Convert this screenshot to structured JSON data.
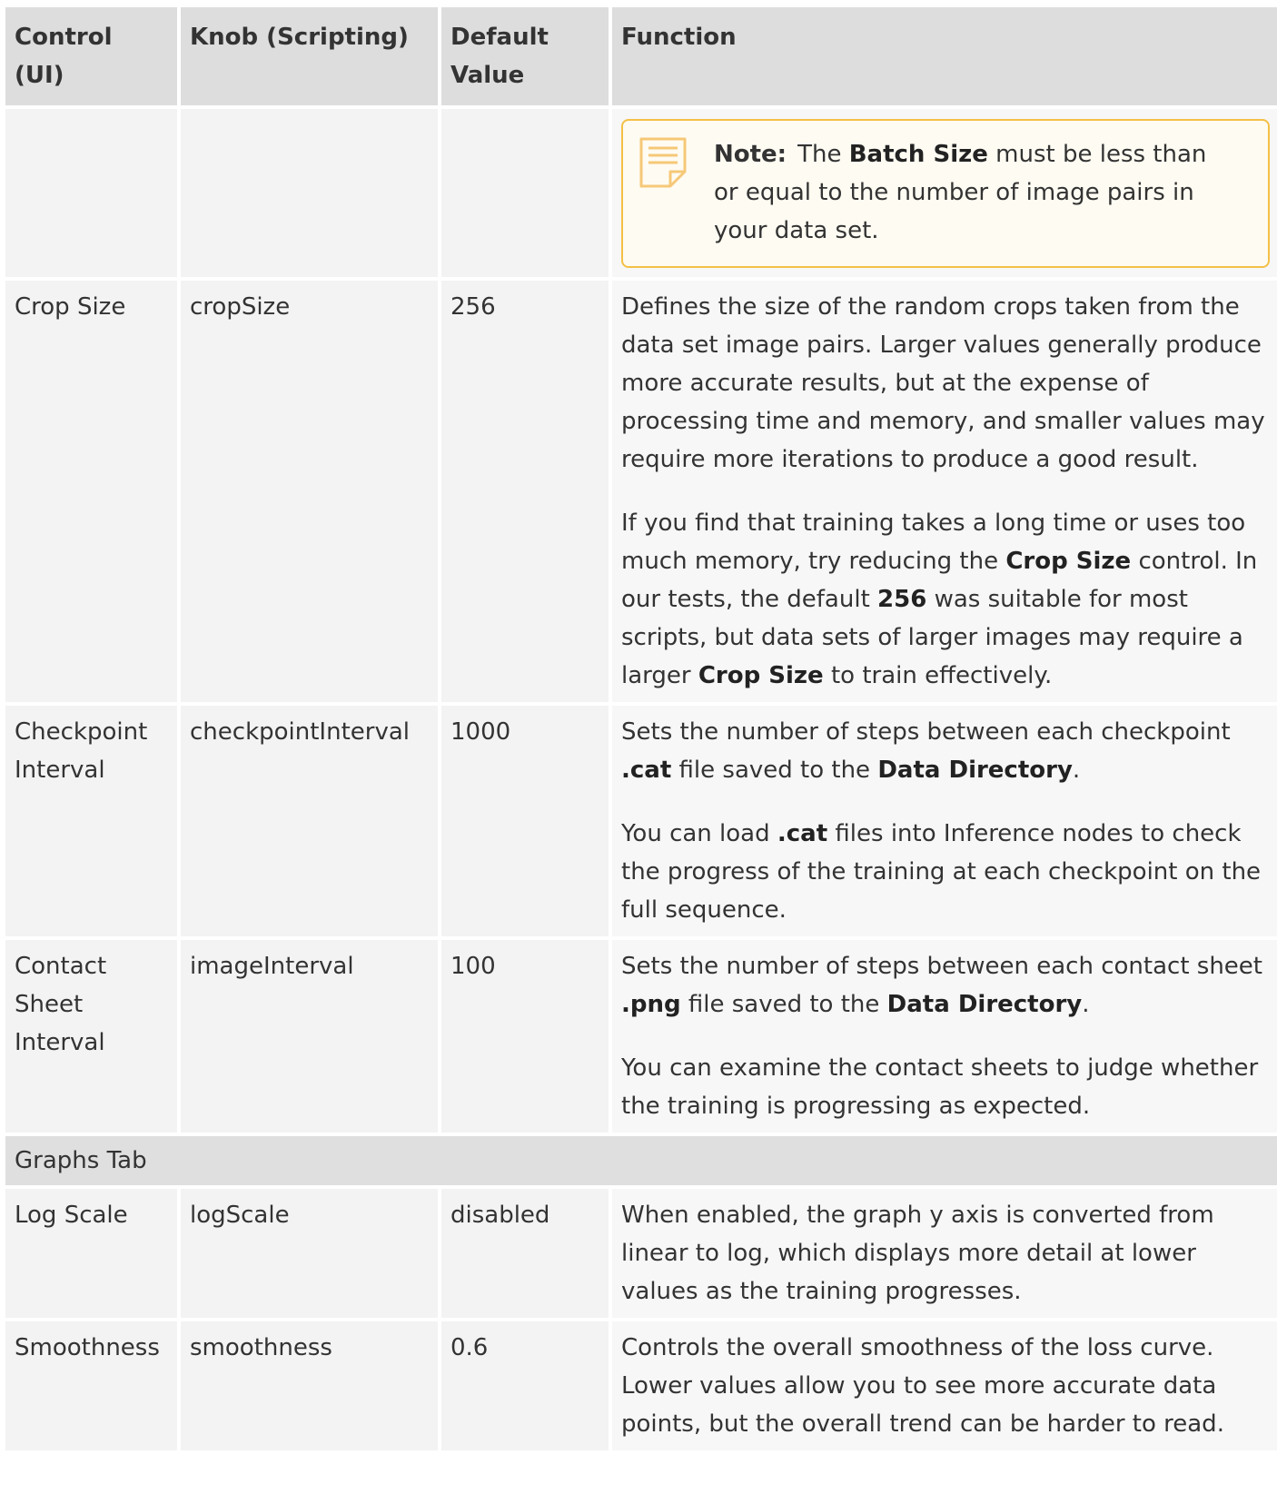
{
  "table": {
    "headers": [
      "Control (UI)",
      "Knob (Scripting)",
      "Default Value",
      "Function"
    ],
    "note_row": {
      "label": "Note:",
      "t1": "The ",
      "b1": "Batch Size",
      "t2": " must be less than or equal to the number of image pairs in your data set."
    },
    "crop": {
      "control": "Crop Size",
      "knob": "cropSize",
      "default": "256",
      "p1": "Defines the size of the random crops taken from the data set image pairs. Larger values generally produce more accurate results, but at the expense of processing time and memory, and smaller values may require more iterations to produce a good result.",
      "p2_t1": "If you find that training takes a long time or uses too much memory, try reducing the ",
      "p2_b1": "Crop Size",
      "p2_t2": " control. In our tests, the default ",
      "p2_b2": "256",
      "p2_t3": " was suitable for most scripts, but data sets of larger images may require a larger ",
      "p2_b3": "Crop Size",
      "p2_t4": " to train effectively."
    },
    "checkpoint": {
      "control": "Checkpoint Interval",
      "knob": "checkpointInterval",
      "default": "1000",
      "p1_t1": "Sets the number of steps between each checkpoint ",
      "p1_b1": ".cat",
      "p1_t2": " file saved to the ",
      "p1_b2": "Data Directory",
      "p1_t3": ".",
      "p2_t1": "You can load ",
      "p2_b1": ".cat",
      "p2_t2": " files into Inference nodes to check the progress of the training at each checkpoint on the full sequence."
    },
    "contact": {
      "control": "Contact Sheet Interval",
      "knob": "imageInterval",
      "default": "100",
      "p1_t1": "Sets the number of steps between each contact sheet ",
      "p1_b1": ".png",
      "p1_t2": " file saved to the ",
      "p1_b2": "Data Directory",
      "p1_t3": ".",
      "p2": "You can examine the contact sheets to judge whether the training is progressing as expected."
    },
    "section": "Graphs Tab",
    "logscale": {
      "control": "Log Scale",
      "knob": "logScale",
      "default": "disabled",
      "p1": "When enabled, the graph y axis is converted from linear to log, which displays more detail at lower values as the training progresses."
    },
    "smoothness": {
      "control": "Smoothness",
      "knob": "smoothness",
      "default": "0.6",
      "p1": "Controls the overall smoothness of the loss curve. Lower values allow you to see more accurate data points, but the overall trend can be harder to read."
    }
  },
  "colors": {
    "header_bg": "#dddddd",
    "cell_bg": "#f3f3f3",
    "note_border": "#f4c046",
    "note_icon": "#f6c878"
  },
  "icons": {
    "note": "note-icon"
  }
}
